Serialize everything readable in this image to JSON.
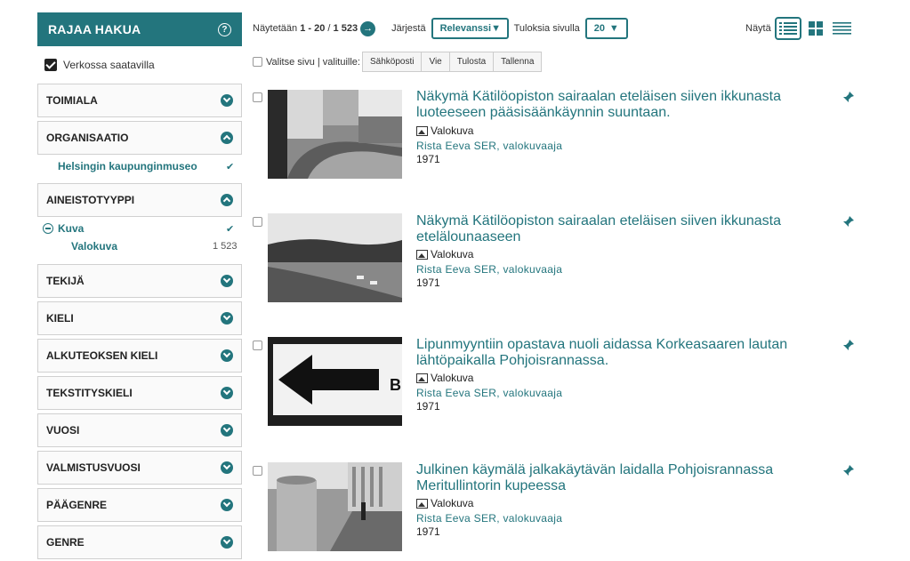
{
  "sidebar": {
    "header": "RAJAA HAKUA",
    "help_icon": "?",
    "online_label": "Verkossa saatavilla",
    "facets": {
      "toimiala": "TOIMIALA",
      "organisaatio": "ORGANISAATIO",
      "organisaatio_value": "Helsingin kaupunginmuseo",
      "aineistotyyppi": "AINEISTOTYYPPI",
      "aineisto_kuva": "Kuva",
      "aineisto_valokuva": "Valokuva",
      "aineisto_valokuva_count": "1 523",
      "tekija": "TEKIJÄ",
      "kieli": "KIELI",
      "alkuteoksen_kieli": "ALKUTEOKSEN KIELI",
      "tekstityskieli": "TEKSTITYSKIELI",
      "vuosi": "VUOSI",
      "valmistusvuosi": "VALMISTUSVUOSI",
      "paagenre": "PÄÄGENRE",
      "genre": "GENRE"
    }
  },
  "topbar": {
    "showing_prefix": "Näytetään",
    "range": "1 - 20",
    "separator": "/",
    "total": "1 523",
    "go_icon": "→",
    "sort_label": "Järjestä",
    "sort_value": "Relevanssi",
    "per_page_label": "Tuloksia sivulla",
    "per_page_value": "20",
    "view_label": "Näytä"
  },
  "bulk": {
    "label": "Valitse sivu | valituille:",
    "buttons": [
      "Sähköposti",
      "Vie",
      "Tulosta",
      "Tallenna"
    ]
  },
  "results": [
    {
      "title": "Näkymä Kätilöopiston sairaalan eteläisen siiven ikkunasta luoteeseen pääsisäänkäynnin suuntaan.",
      "format": "Valokuva",
      "author": "Rista Eeva SER, valokuvaaja",
      "year": "1971"
    },
    {
      "title": "Näkymä Kätilöopiston sairaalan eteläisen siiven ikkunasta etelälounaaseen",
      "format": "Valokuva",
      "author": "Rista Eeva SER, valokuvaaja",
      "year": "1971"
    },
    {
      "title": "Lipunmyyntiin opastava nuoli aidassa Korkeasaaren lautan lähtöpaikalla Pohjoisrannassa.",
      "format": "Valokuva",
      "author": "Rista Eeva SER, valokuvaaja",
      "year": "1971"
    },
    {
      "title": "Julkinen käymälä jalkakäytävän laidalla Pohjoisrannassa Meritullintorin kupeessa",
      "format": "Valokuva",
      "author": "Rista Eeva SER, valokuvaaja",
      "year": "1971"
    }
  ],
  "thumb3_sign_text": "B",
  "colors": {
    "accent": "#23757d"
  }
}
